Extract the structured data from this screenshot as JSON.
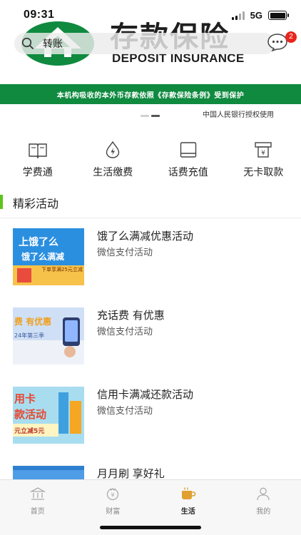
{
  "status_bar": {
    "time": "09:31",
    "network": "5G"
  },
  "banner": {
    "title_cn": "存款保险",
    "title_en": "DEPOSIT INSURANCE",
    "strip_text": "本机构吸收的本外币存款依照《存款保险条例》受到保护",
    "authorization": "中国人民银行授权使用"
  },
  "search": {
    "text": "转账"
  },
  "messages": {
    "badge_count": "2"
  },
  "quick_menu": [
    {
      "label": "学费通",
      "icon": "book-icon"
    },
    {
      "label": "生活缴费",
      "icon": "utility-drop-icon"
    },
    {
      "label": "话费充值",
      "icon": "phone-recharge-icon"
    },
    {
      "label": "无卡取款",
      "icon": "cardless-withdraw-icon"
    }
  ],
  "section": {
    "title": "精彩活动"
  },
  "activities": [
    {
      "title": "饿了么满减优惠活动",
      "subtitle": "微信支付活动",
      "thumb_text": [
        "上饿了么",
        "饿了么满减",
        "下单享满25元立减"
      ]
    },
    {
      "title": "充话费 有优惠",
      "subtitle": "微信支付活动",
      "thumb_text": [
        "费 有优惠",
        "24年第三季"
      ]
    },
    {
      "title": "信用卡满减还款活动",
      "subtitle": "微信支付活动",
      "thumb_text": [
        "用卡",
        "款活动",
        "元立减5元"
      ]
    },
    {
      "title": "月月刷 享好礼",
      "subtitle": ""
    }
  ],
  "tab_bar": [
    {
      "label": "首页",
      "icon": "bank-icon"
    },
    {
      "label": "财富",
      "icon": "wealth-icon"
    },
    {
      "label": "生活",
      "icon": "coffee-cup-icon"
    },
    {
      "label": "我的",
      "icon": "user-icon"
    }
  ],
  "colors": {
    "brand_green": "#0f8a3f",
    "accent_green": "#5cc41a",
    "tab_active": "#e0a030",
    "badge": "#e8251e"
  }
}
